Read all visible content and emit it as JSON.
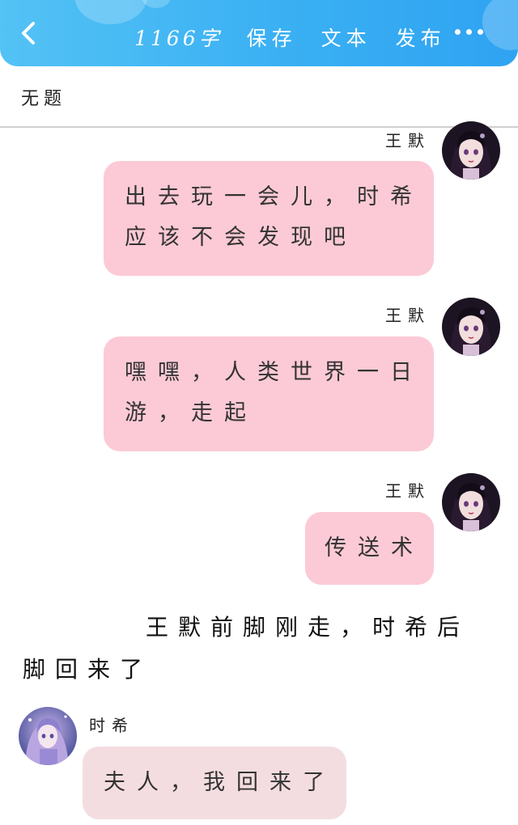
{
  "header": {
    "word_count": "1166字",
    "save_label": "保存",
    "text_label": "文本",
    "publish_label": "发布",
    "back_icon": "chevron-left-icon",
    "more_icon": "more-dots-icon",
    "color": "#3ab0f3"
  },
  "document": {
    "title": "无题"
  },
  "messages": [
    {
      "sender": "王默",
      "text": "出去玩一会儿，时希应该不会发现吧",
      "side": "right",
      "color": "#fccad6"
    },
    {
      "sender": "王默",
      "text": "嘿嘿，人类世界一日游，走起",
      "side": "right",
      "color": "#fccad6"
    },
    {
      "sender": "王默",
      "text": "传送术",
      "side": "right",
      "color": "#fccad6"
    }
  ],
  "narration": "王默前脚刚走，时希后脚回来了",
  "reply": {
    "sender": "时希",
    "text": "夫人，我回来了",
    "side": "left",
    "color": "#f4dde0"
  }
}
